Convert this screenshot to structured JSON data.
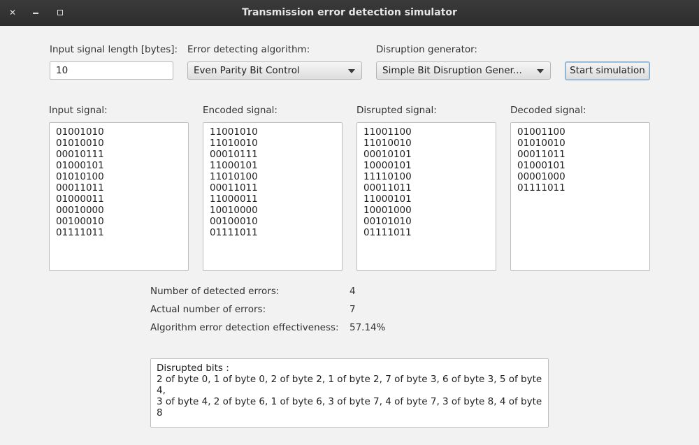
{
  "window": {
    "title": "Transmission error detection simulator"
  },
  "controls": {
    "length_label": "Input signal length [bytes]:",
    "length_value": "10",
    "algorithm_label": "Error detecting algorithm:",
    "algorithm_value": "Even Parity Bit Control",
    "disruption_label": "Disruption generator:",
    "disruption_value": "Simple Bit Disruption Gener...",
    "start_label": "Start simulation"
  },
  "signals": {
    "input": {
      "label": "Input signal:",
      "bytes": [
        "01001010",
        "01010010",
        "00010111",
        "01000101",
        "01010100",
        "00011011",
        "01000011",
        "00010000",
        "00100010",
        "01111011"
      ]
    },
    "encoded": {
      "label": "Encoded signal:",
      "bytes": [
        "11001010",
        "11010010",
        "00010111",
        "11000101",
        "11010100",
        "00011011",
        "11000011",
        "10010000",
        "00100010",
        "01111011"
      ]
    },
    "disrupted": {
      "label": "Disrupted signal:",
      "bytes": [
        "11001100",
        "11010010",
        "00010101",
        "10000101",
        "11110100",
        "00011011",
        "11000101",
        "10001000",
        "00101010",
        "01111011"
      ]
    },
    "decoded": {
      "label": "Decoded signal:",
      "bytes": [
        "01001100",
        "01010010",
        "00011011",
        "01000101",
        "00001000",
        "01111011"
      ]
    }
  },
  "stats": {
    "detected_label": "Number of detected errors:",
    "detected_value": "4",
    "actual_label": "Actual number of errors:",
    "actual_value": "7",
    "effectiveness_label": "Algorithm error detection effectiveness:",
    "effectiveness_value": "57.14%"
  },
  "disrupted_bits": {
    "header": "Disrupted bits :",
    "line1": "2 of byte 0, 1 of byte 0, 2 of byte 2, 1 of byte 2, 7 of byte 3, 6 of byte 3, 5 of byte 4,",
    "line2": "3 of byte 4, 2 of byte 6, 1 of byte 6, 3 of byte 7, 4 of byte 7, 3 of byte 8, 4 of byte 8"
  }
}
